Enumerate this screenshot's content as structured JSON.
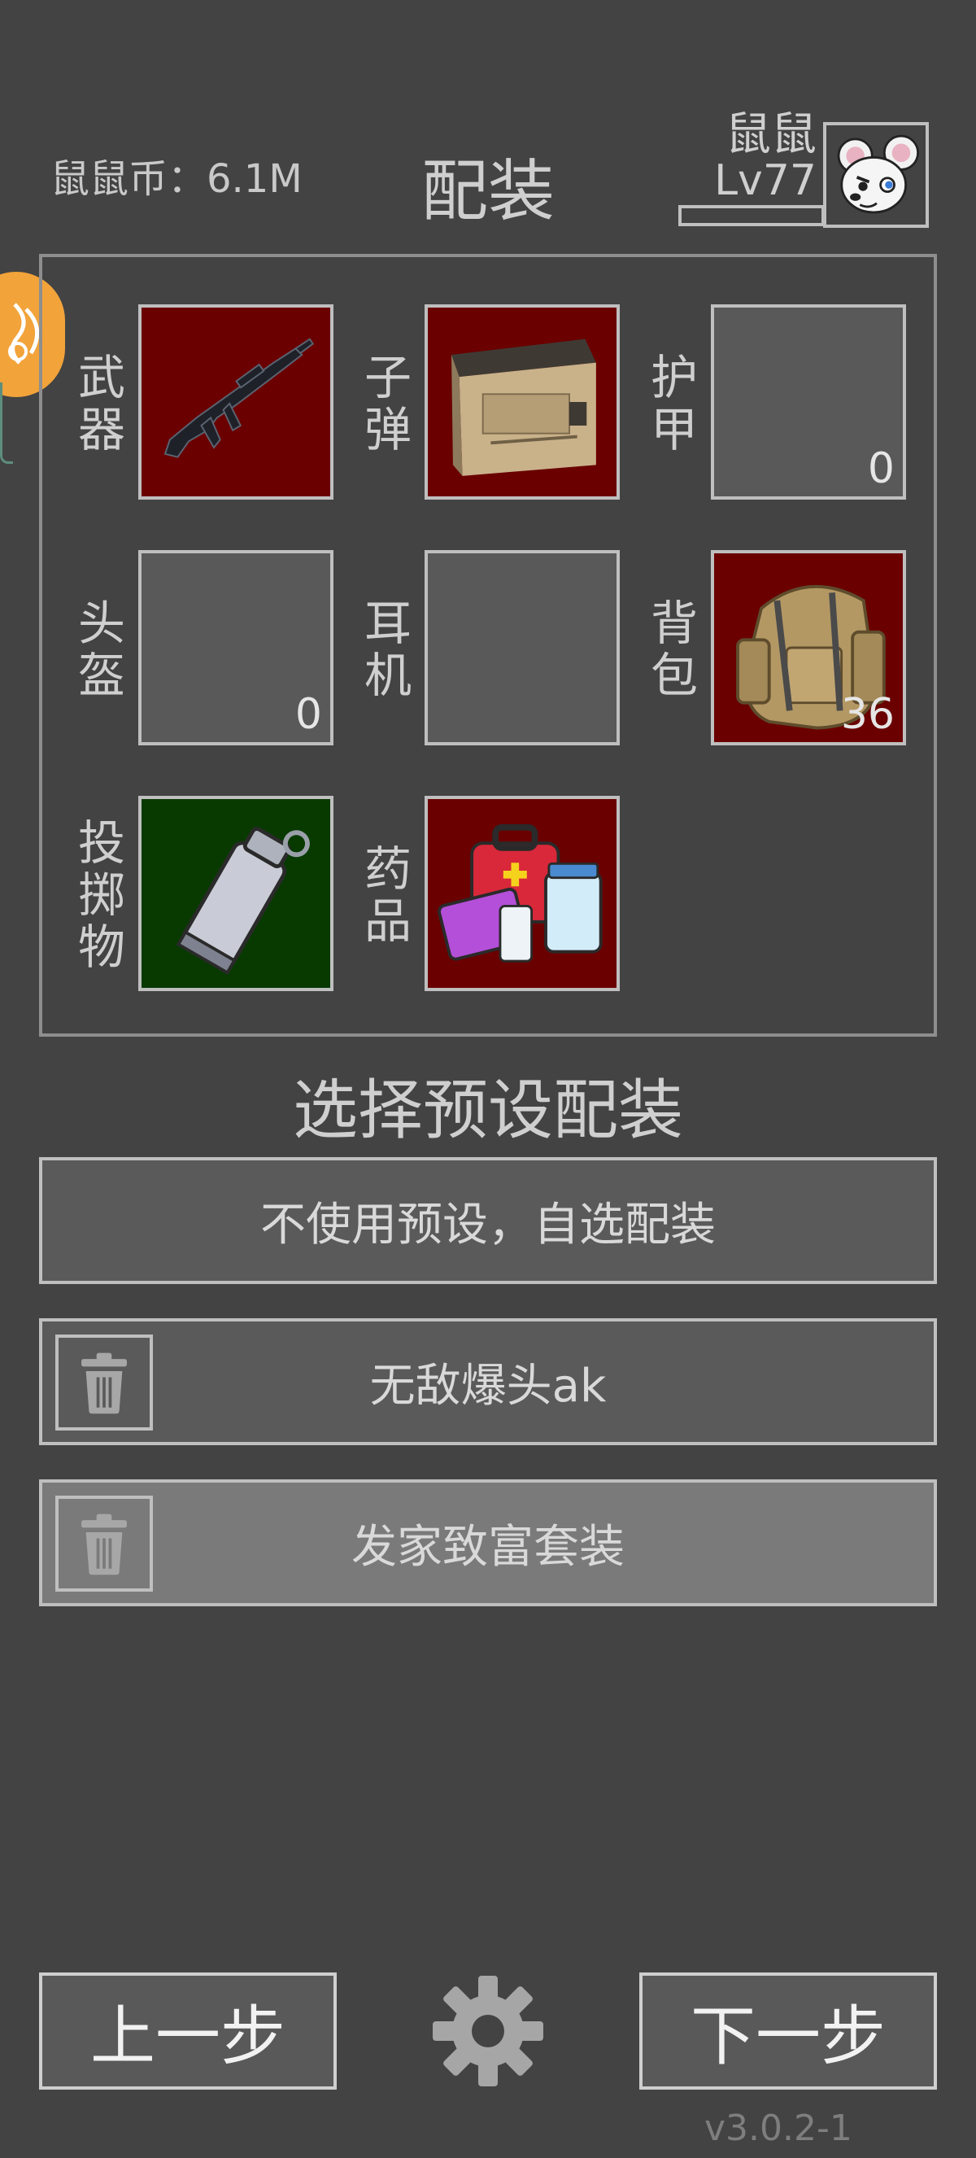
{
  "header": {
    "coins_label": "鼠鼠币：6.1M",
    "title": "配装",
    "player_name": "鼠鼠",
    "player_level": "Lv77",
    "xp_fill_fraction": 0.0
  },
  "loadout": {
    "slots": [
      {
        "label": "武器",
        "item": "rifle-icon",
        "count": ""
      },
      {
        "label": "子弹",
        "item": "ammo-box-icon",
        "count": ""
      },
      {
        "label": "护甲",
        "item": "",
        "count": "0"
      },
      {
        "label": "头盔",
        "item": "",
        "count": "0"
      },
      {
        "label": "耳机",
        "item": "",
        "count": ""
      },
      {
        "label": "背包",
        "item": "backpack-icon",
        "count": "36"
      },
      {
        "label": "投掷物",
        "item": "grenade-icon",
        "count": ""
      },
      {
        "label": "药品",
        "item": "medkit-icon",
        "count": ""
      }
    ]
  },
  "presets": {
    "heading": "选择预设配装",
    "items": [
      {
        "label": "不使用预设，自选配装"
      },
      {
        "label": "无敌爆头ak"
      },
      {
        "label": "发家致富套装"
      }
    ]
  },
  "footer": {
    "prev_label": "上一步",
    "next_label": "下一步",
    "version": "v3.0.2-1"
  },
  "colors": {
    "background": "#434343",
    "slot_red": "#6a0000",
    "slot_green": "#083a00",
    "accent_orange": "#f2a33a"
  }
}
